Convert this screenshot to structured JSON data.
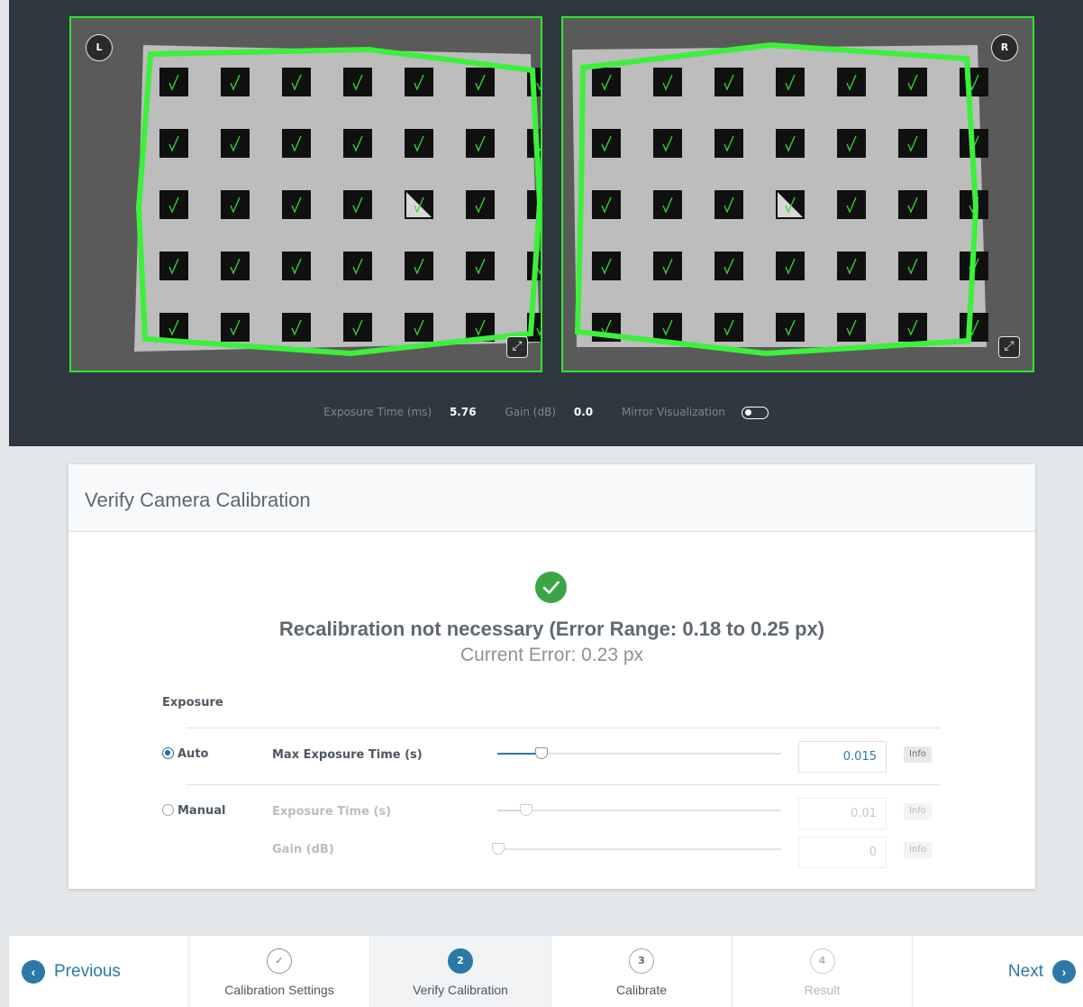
{
  "cameras": {
    "left_badge": "L",
    "right_badge": "R"
  },
  "status": {
    "exposure_label": "Exposure Time (ms)",
    "exposure_value": "5.76",
    "gain_label": "Gain (dB)",
    "gain_value": "0.0",
    "mirror_label": "Mirror Visualization",
    "mirror_on": false
  },
  "card": {
    "title": "Verify Camera Calibration",
    "result_main": "Recalibration not necessary (Error Range: 0.18 to 0.25 px)",
    "result_sub": "Current Error: 0.23 px",
    "exposure_heading": "Exposure",
    "auto_label": "Auto",
    "manual_label": "Manual",
    "mode_selected": "Auto",
    "max_exposure_label": "Max Exposure Time (s)",
    "max_exposure_value": "0.015",
    "max_exposure_fraction": 0.15,
    "exposure_time_label": "Exposure Time (s)",
    "exposure_time_value": "0.01",
    "exposure_time_fraction": 0.1,
    "gain_label": "Gain (dB)",
    "gain_value": "0",
    "gain_fraction": 0,
    "info_label": "Info"
  },
  "wizard": {
    "previous_label": "Previous",
    "next_label": "Next",
    "steps": [
      {
        "number": "✓",
        "label": "Calibration Settings",
        "state": "done"
      },
      {
        "number": "2",
        "label": "Verify Calibration",
        "state": "current"
      },
      {
        "number": "3",
        "label": "Calibrate",
        "state": "pending"
      },
      {
        "number": "4",
        "label": "Result",
        "state": "future"
      }
    ]
  },
  "colors": {
    "accent": "#2c79a8",
    "success": "#3aa545",
    "detection": "#2ee62e",
    "dark_bg": "#2f3740"
  }
}
